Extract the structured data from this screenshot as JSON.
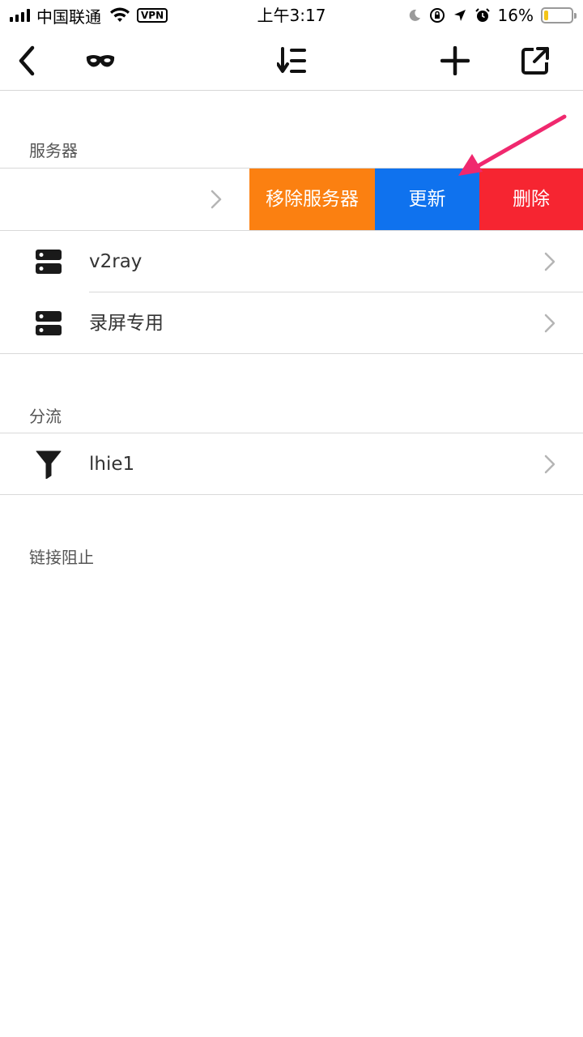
{
  "status_bar": {
    "carrier": "中国联通",
    "vpn": "VPN",
    "time": "上午3:17",
    "battery_pct": "16%",
    "battery_level": 0.16
  },
  "nav": {
    "back": "back-icon",
    "incognito": "mask-icon",
    "sort": "sort-icon",
    "add": "plus-icon",
    "share": "share-icon"
  },
  "sections": {
    "servers": {
      "title": "服务器",
      "actions": {
        "remove": "移除服务器",
        "update": "更新",
        "delete": "删除"
      },
      "items": [
        {
          "label": "v2ray",
          "icon": "server-icon"
        },
        {
          "label": "录屏专用",
          "icon": "server-icon"
        }
      ]
    },
    "routing": {
      "title": "分流",
      "items": [
        {
          "label": "lhie1",
          "icon": "filter-icon"
        }
      ]
    },
    "block": {
      "title": "链接阻止"
    }
  },
  "colors": {
    "remove": "#fb8011",
    "update": "#0f72ee",
    "delete": "#f62531",
    "annotation_arrow": "#f0286e"
  }
}
